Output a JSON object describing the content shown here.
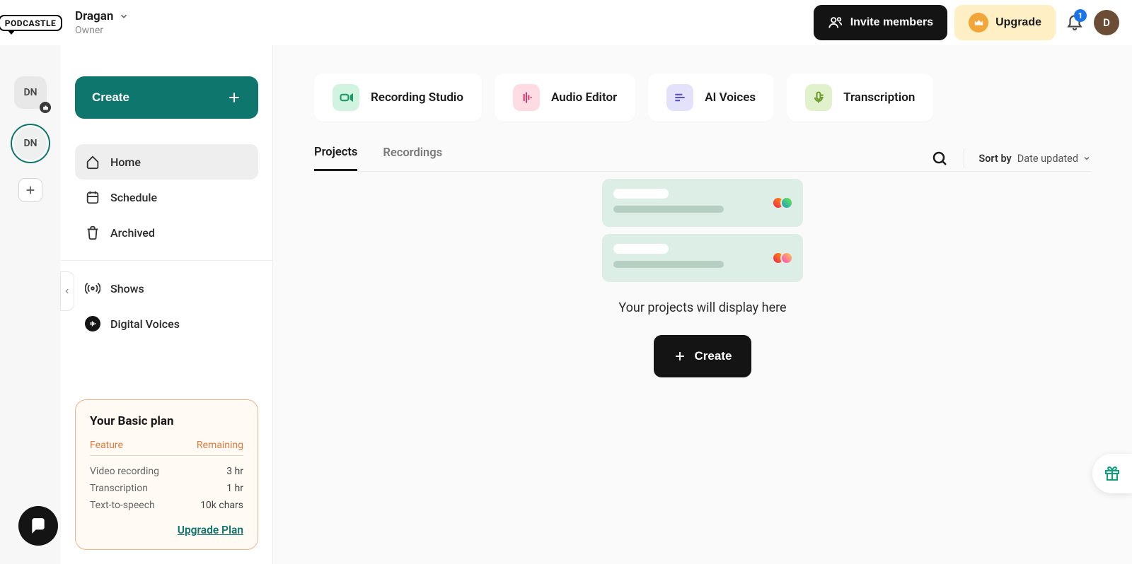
{
  "brand": "PODCASTLE",
  "workspace": {
    "name": "Dragan",
    "role": "Owner",
    "initials": "DN"
  },
  "header": {
    "invite": "Invite members",
    "upgrade": "Upgrade",
    "notification_count": "1",
    "avatar_initial": "D"
  },
  "rail": {
    "badges": [
      {
        "initials": "DN"
      },
      {
        "initials": "DN"
      }
    ]
  },
  "sidebar": {
    "create": "Create",
    "items": [
      {
        "label": "Home"
      },
      {
        "label": "Schedule"
      },
      {
        "label": "Archived"
      }
    ],
    "secondary": [
      {
        "label": "Shows"
      },
      {
        "label": "Digital Voices"
      }
    ],
    "plan": {
      "title": "Your Basic plan",
      "head_feature": "Feature",
      "head_remaining": "Remaining",
      "rows": [
        {
          "feature": "Video recording",
          "remaining": "3 hr"
        },
        {
          "feature": "Transcription",
          "remaining": "1 hr"
        },
        {
          "feature": "Text-to-speech",
          "remaining": "10k chars"
        }
      ],
      "upgrade": "Upgrade Plan"
    }
  },
  "main": {
    "cards": [
      {
        "label": "Recording Studio"
      },
      {
        "label": "Audio Editor"
      },
      {
        "label": "AI Voices"
      },
      {
        "label": "Transcription"
      }
    ],
    "tabs": [
      {
        "label": "Projects"
      },
      {
        "label": "Recordings"
      }
    ],
    "sort_label": "Sort by",
    "sort_value": "Date updated",
    "empty_text": "Your projects will display here",
    "create": "Create"
  }
}
